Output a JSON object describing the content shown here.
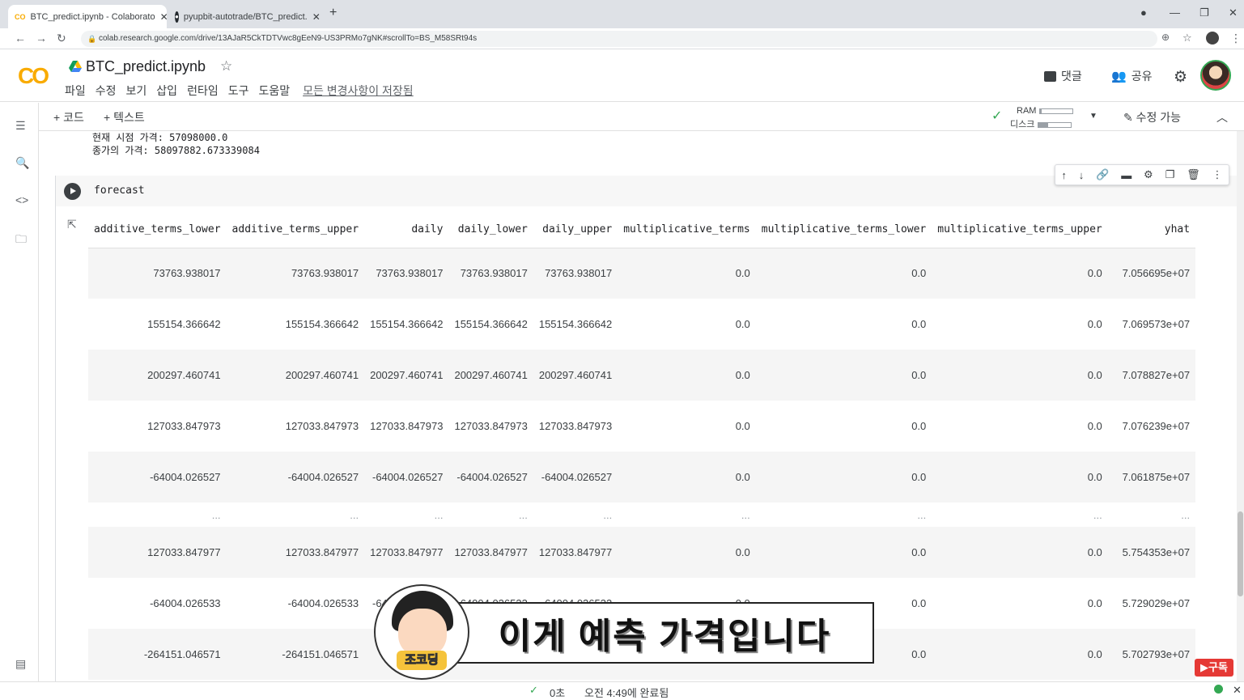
{
  "browser": {
    "tabs": [
      {
        "title": "BTC_predict.ipynb - Colaborato",
        "active": true
      },
      {
        "title": "pyupbit-autotrade/BTC_predict.",
        "active": false
      }
    ],
    "url": "colab.research.google.com/drive/13AJaR5CkTDTVwc8gEeN9-US3PRMo7gNK#scrollTo=BS_M58SRt94s"
  },
  "header": {
    "logo": "CO",
    "title": "BTC_predict.ipynb",
    "menu": [
      "파일",
      "수정",
      "보기",
      "삽입",
      "런타임",
      "도구",
      "도움말"
    ],
    "saved_status": "모든 변경사항이 저장됨",
    "comment_label": "댓글",
    "share_label": "공유"
  },
  "toolbar": {
    "add_code": "+ 코드",
    "add_text": "+ 텍스트",
    "ram_label": "RAM",
    "disk_label": "디스크",
    "ram_usage": 0.05,
    "disk_usage": 0.3,
    "edit_label": "수정 가능"
  },
  "prev_output": {
    "line1": "현재 시점 가격:  57098000.0",
    "line2": "종가의 가격:  58097882.673339084"
  },
  "cell": {
    "code": "forecast"
  },
  "table": {
    "columns": [
      "additive_terms_lower",
      "additive_terms_upper",
      "daily",
      "daily_lower",
      "daily_upper",
      "multiplicative_terms",
      "multiplicative_terms_lower",
      "multiplicative_terms_upper",
      "yhat"
    ],
    "rows": [
      [
        "73763.938017",
        "73763.938017",
        "73763.938017",
        "73763.938017",
        "73763.938017",
        "0.0",
        "0.0",
        "0.0",
        "7.056695e+07"
      ],
      [
        "155154.366642",
        "155154.366642",
        "155154.366642",
        "155154.366642",
        "155154.366642",
        "0.0",
        "0.0",
        "0.0",
        "7.069573e+07"
      ],
      [
        "200297.460741",
        "200297.460741",
        "200297.460741",
        "200297.460741",
        "200297.460741",
        "0.0",
        "0.0",
        "0.0",
        "7.078827e+07"
      ],
      [
        "127033.847973",
        "127033.847973",
        "127033.847973",
        "127033.847973",
        "127033.847973",
        "0.0",
        "0.0",
        "0.0",
        "7.076239e+07"
      ],
      [
        "-64004.026527",
        "-64004.026527",
        "-64004.026527",
        "-64004.026527",
        "-64004.026527",
        "0.0",
        "0.0",
        "0.0",
        "7.061875e+07"
      ],
      [
        "...",
        "...",
        "...",
        "...",
        "...",
        "...",
        "...",
        "...",
        "..."
      ],
      [
        "127033.847977",
        "127033.847977",
        "127033.847977",
        "127033.847977",
        "127033.847977",
        "0.0",
        "0.0",
        "0.0",
        "5.754353e+07"
      ],
      [
        "-64004.026533",
        "-64004.026533",
        "-64004.026533",
        "-64004.026533",
        "-64004.026533",
        "0.0",
        "0.0",
        "0.0",
        "5.729029e+07"
      ],
      [
        "-264151.046571",
        "-264151.046571",
        "",
        "",
        "",
        "0.0",
        "0.0",
        "0.0",
        "5.702793e+07"
      ]
    ]
  },
  "overlay": {
    "subtitle": "이게 예측 가격입니다",
    "badge": "조코딩",
    "subscribe": "▶구독"
  },
  "status": {
    "duration": "0초",
    "completed": "오전 4:49에 완료됨"
  },
  "colors": {
    "logo_orange": "#f9ab00",
    "running_green": "#34a853",
    "subscribe_red": "#e53935"
  }
}
